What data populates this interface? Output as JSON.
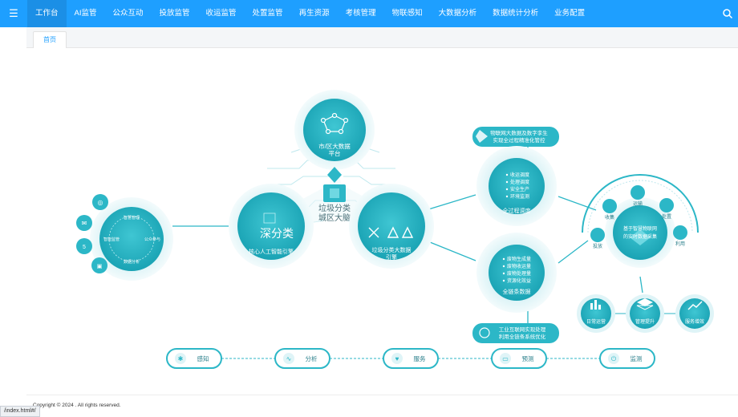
{
  "nav": {
    "items": [
      "工作台",
      "AI监管",
      "公众互动",
      "投放监管",
      "收运监管",
      "处置监管",
      "再生资源",
      "考核管理",
      "物联感知",
      "大数据分析",
      "数据统计分析",
      "业务配置"
    ],
    "active_index": 0
  },
  "tabs": [
    {
      "label": "首页"
    }
  ],
  "diagram": {
    "center_title": [
      "垃圾分类",
      "城区大脑"
    ],
    "top_circle": [
      "市/区大数据",
      "平台"
    ],
    "left_left_circle": {
      "center": "",
      "labels": [
        "智慧管理",
        "智能监管",
        "数据分析",
        "公众参与"
      ]
    },
    "left_circle_label": "核心人工智能引擎",
    "left_circle_logo": "深分类",
    "right_circle_label": [
      "垃圾分类大数据",
      "引擎"
    ],
    "bubble_top": [
      "物联网大数据及数字孪生",
      "实现全过程精准化管控"
    ],
    "bubble_bottom": [
      "工业互联网实现处理",
      "利用全链条系统优化"
    ],
    "circle_control": {
      "items": [
        "收运调度",
        "处理调度",
        "安全生产",
        "环境监测"
      ],
      "title": "全过程调度"
    },
    "circle_data": {
      "items": [
        "废物生成量",
        "废物收运量",
        "废物处理量",
        "资源化效益"
      ],
      "title": "全链条数据"
    },
    "iot_center": [
      "基于智慧物联网",
      "的实时数据采集"
    ],
    "iot_orbit": [
      "投放",
      "收集",
      "运输",
      "处置",
      "利用"
    ],
    "bottom_right": [
      "日常运营",
      "管理提升",
      "服务增效"
    ],
    "flow": [
      "感知",
      "分析",
      "服务",
      "预测",
      "监测"
    ]
  },
  "footer": {
    "copyright": "Copyright © 2024 . All rights reserved."
  },
  "statusbar": {
    "url": "/index.html#/"
  },
  "colors": {
    "primary": "#1e9fff",
    "teal": "#2cb7c7",
    "teal_dark": "#1aa3b4",
    "teal_light": "#dff4f7"
  }
}
